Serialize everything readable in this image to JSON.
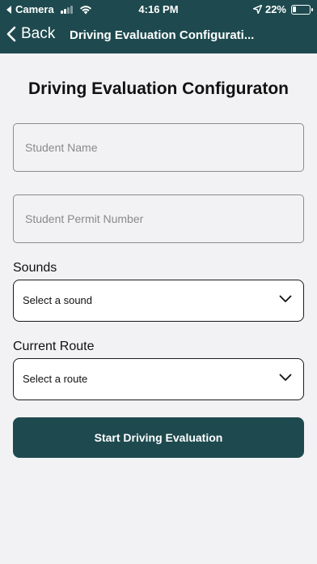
{
  "status_bar": {
    "carrier_back": "Camera",
    "time": "4:16 PM",
    "battery": "22%",
    "battery_level": 0.22
  },
  "nav": {
    "back_label": "Back",
    "title": "Driving Evaluation Configurati..."
  },
  "page": {
    "title": "Driving Evaluation Configuraton"
  },
  "form": {
    "student_name_placeholder": "Student Name",
    "permit_placeholder": "Student Permit Number",
    "sounds_label": "Sounds",
    "sounds_value": "Select a sound",
    "route_label": "Current Route",
    "route_value": "Select a route",
    "submit_label": "Start Driving Evaluation"
  },
  "colors": {
    "brand": "#1e4a4f",
    "background": "#f2f2f4"
  }
}
